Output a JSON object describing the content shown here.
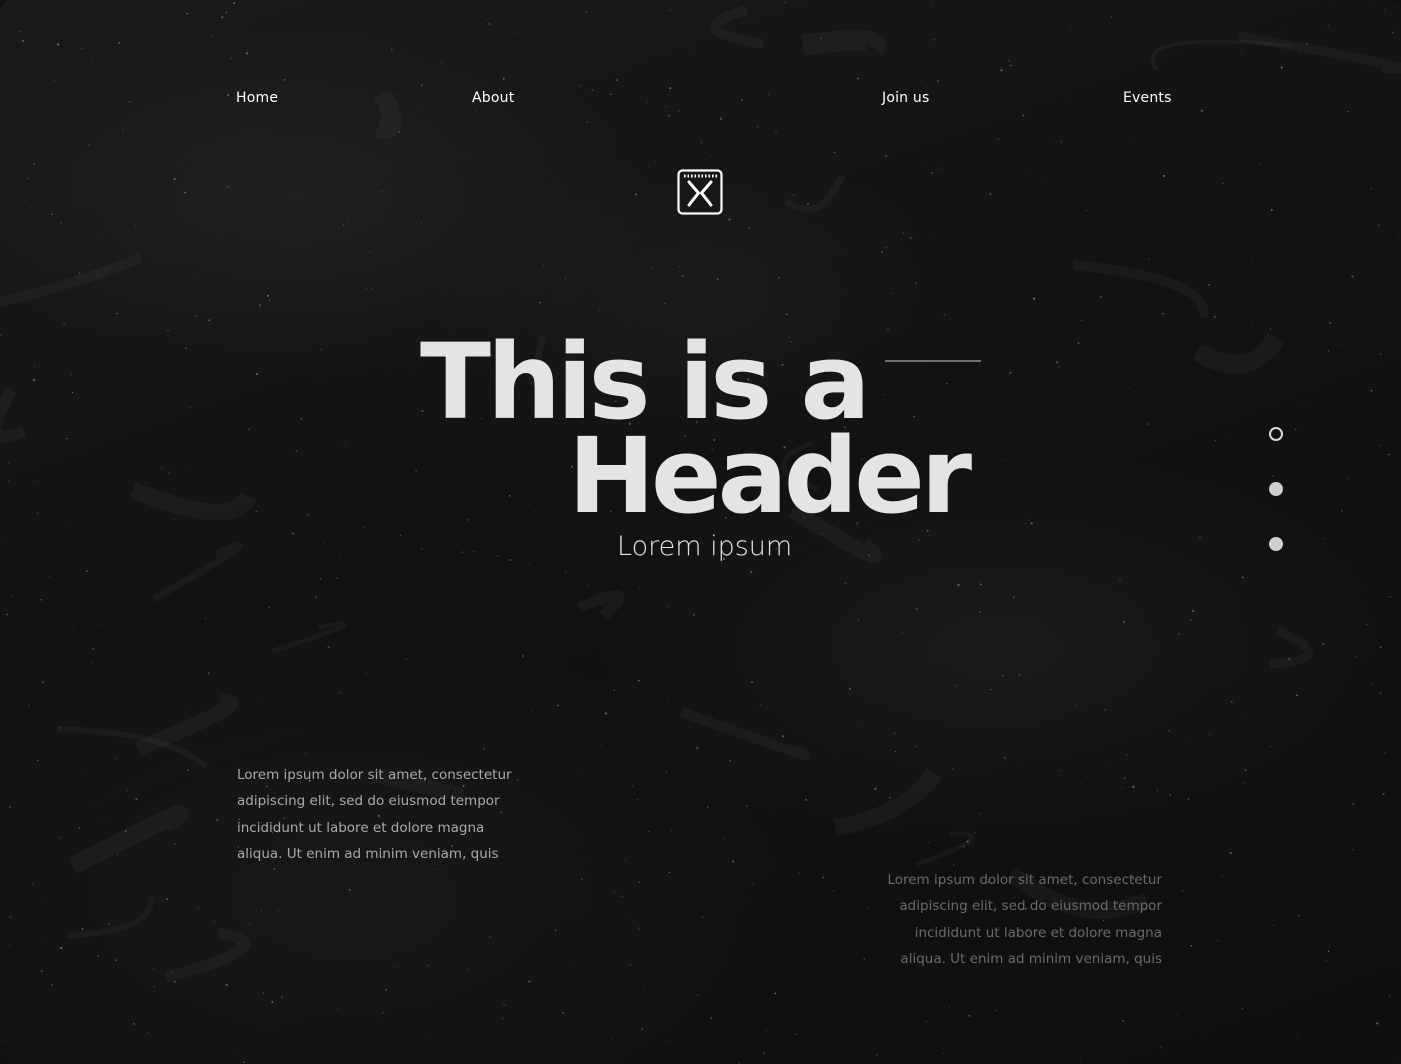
{
  "nav": {
    "home": "Home",
    "about": "About",
    "join": "Join us",
    "events": "Events"
  },
  "logo": {
    "icon": "x-box-logo-icon"
  },
  "hero": {
    "title_line_1": "This is a",
    "title_line_2": "Header",
    "subtitle": "Lorem ipsum"
  },
  "pagination": {
    "dots": [
      {
        "state": "active"
      },
      {
        "state": "inactive"
      },
      {
        "state": "inactive"
      }
    ]
  },
  "paragraph_left": {
    "lines": [
      "Lorem ipsum dolor sit amet, consectetur",
      "adipiscing elit, sed do eiusmod tempor",
      "incididunt ut labore et dolore magna",
      "aliqua. Ut enim ad minim veniam, quis"
    ]
  },
  "paragraph_right": {
    "lines": [
      "Lorem ipsum dolor sit amet, consectetur",
      "adipiscing elit, sed do eiusmod tempor",
      "incididunt ut labore et dolore magna",
      "aliqua. Ut enim ad minim veniam, quis"
    ]
  },
  "colors": {
    "background": "#121212",
    "title": "#e4e4e4",
    "nav_text": "#ffffff",
    "paragraph_left": "#a9a9a9",
    "paragraph_right": "#6a6a6a"
  }
}
